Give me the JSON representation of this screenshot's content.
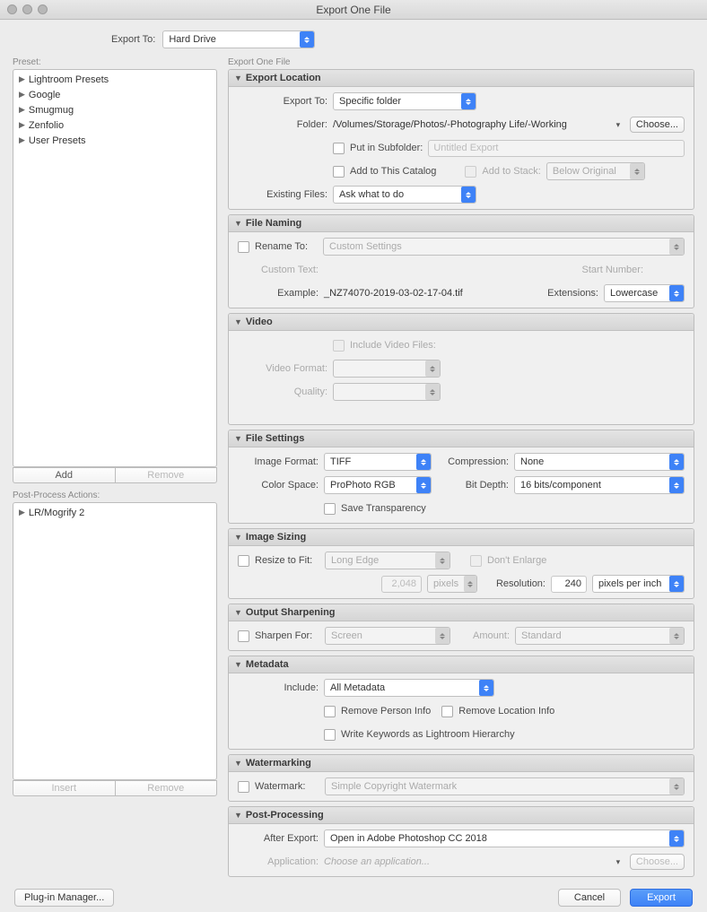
{
  "window_title": "Export One File",
  "export_to_label": "Export To:",
  "export_to_value": "Hard Drive",
  "preset_header": "Preset:",
  "presets": [
    "Lightroom Presets",
    "Google",
    "Smugmug",
    "Zenfolio",
    "User Presets"
  ],
  "add_btn": "Add",
  "remove_btn": "Remove",
  "insert_btn": "Insert",
  "postproc_header": "Post-Process Actions:",
  "postproc_items": [
    "LR/Mogrify 2"
  ],
  "right_header": "Export One File",
  "sections": {
    "export_location": {
      "title": "Export Location",
      "export_to_label": "Export To:",
      "export_to_value": "Specific folder",
      "folder_label": "Folder:",
      "folder_value": "/Volumes/Storage/Photos/-Photography Life/-Working",
      "choose_btn": "Choose...",
      "put_subfolder_label": "Put in Subfolder:",
      "put_subfolder_placeholder": "Untitled Export",
      "add_catalog_label": "Add to This Catalog",
      "add_stack_label": "Add to Stack:",
      "add_stack_value": "Below Original",
      "existing_label": "Existing Files:",
      "existing_value": "Ask what to do"
    },
    "file_naming": {
      "title": "File Naming",
      "rename_label": "Rename To:",
      "rename_value": "Custom Settings",
      "custom_text_label": "Custom Text:",
      "start_number_label": "Start Number:",
      "example_label": "Example:",
      "example_value": "_NZ74070-2019-03-02-17-04.tif",
      "extensions_label": "Extensions:",
      "extensions_value": "Lowercase"
    },
    "video": {
      "title": "Video",
      "include_label": "Include Video Files:",
      "format_label": "Video Format:",
      "quality_label": "Quality:"
    },
    "file_settings": {
      "title": "File Settings",
      "format_label": "Image Format:",
      "format_value": "TIFF",
      "compression_label": "Compression:",
      "compression_value": "None",
      "colorspace_label": "Color Space:",
      "colorspace_value": "ProPhoto RGB",
      "bitdepth_label": "Bit Depth:",
      "bitdepth_value": "16 bits/component",
      "transparency_label": "Save Transparency"
    },
    "image_sizing": {
      "title": "Image Sizing",
      "resize_label": "Resize to Fit:",
      "resize_value": "Long Edge",
      "dont_enlarge": "Don't Enlarge",
      "size_value": "2,048",
      "units_value": "pixels",
      "resolution_label": "Resolution:",
      "resolution_value": "240",
      "resolution_units": "pixels per inch"
    },
    "output_sharpening": {
      "title": "Output Sharpening",
      "sharpen_label": "Sharpen For:",
      "sharpen_value": "Screen",
      "amount_label": "Amount:",
      "amount_value": "Standard"
    },
    "metadata": {
      "title": "Metadata",
      "include_label": "Include:",
      "include_value": "All Metadata",
      "remove_person": "Remove Person Info",
      "remove_location": "Remove Location Info",
      "keywords_hierarchy": "Write Keywords as Lightroom Hierarchy"
    },
    "watermarking": {
      "title": "Watermarking",
      "watermark_label": "Watermark:",
      "watermark_value": "Simple Copyright Watermark"
    },
    "post_processing": {
      "title": "Post-Processing",
      "after_label": "After Export:",
      "after_value": "Open in Adobe Photoshop CC 2018",
      "app_label": "Application:",
      "app_placeholder": "Choose an application...",
      "choose_btn": "Choose..."
    }
  },
  "plugin_manager_btn": "Plug-in Manager...",
  "cancel_btn": "Cancel",
  "export_btn": "Export"
}
